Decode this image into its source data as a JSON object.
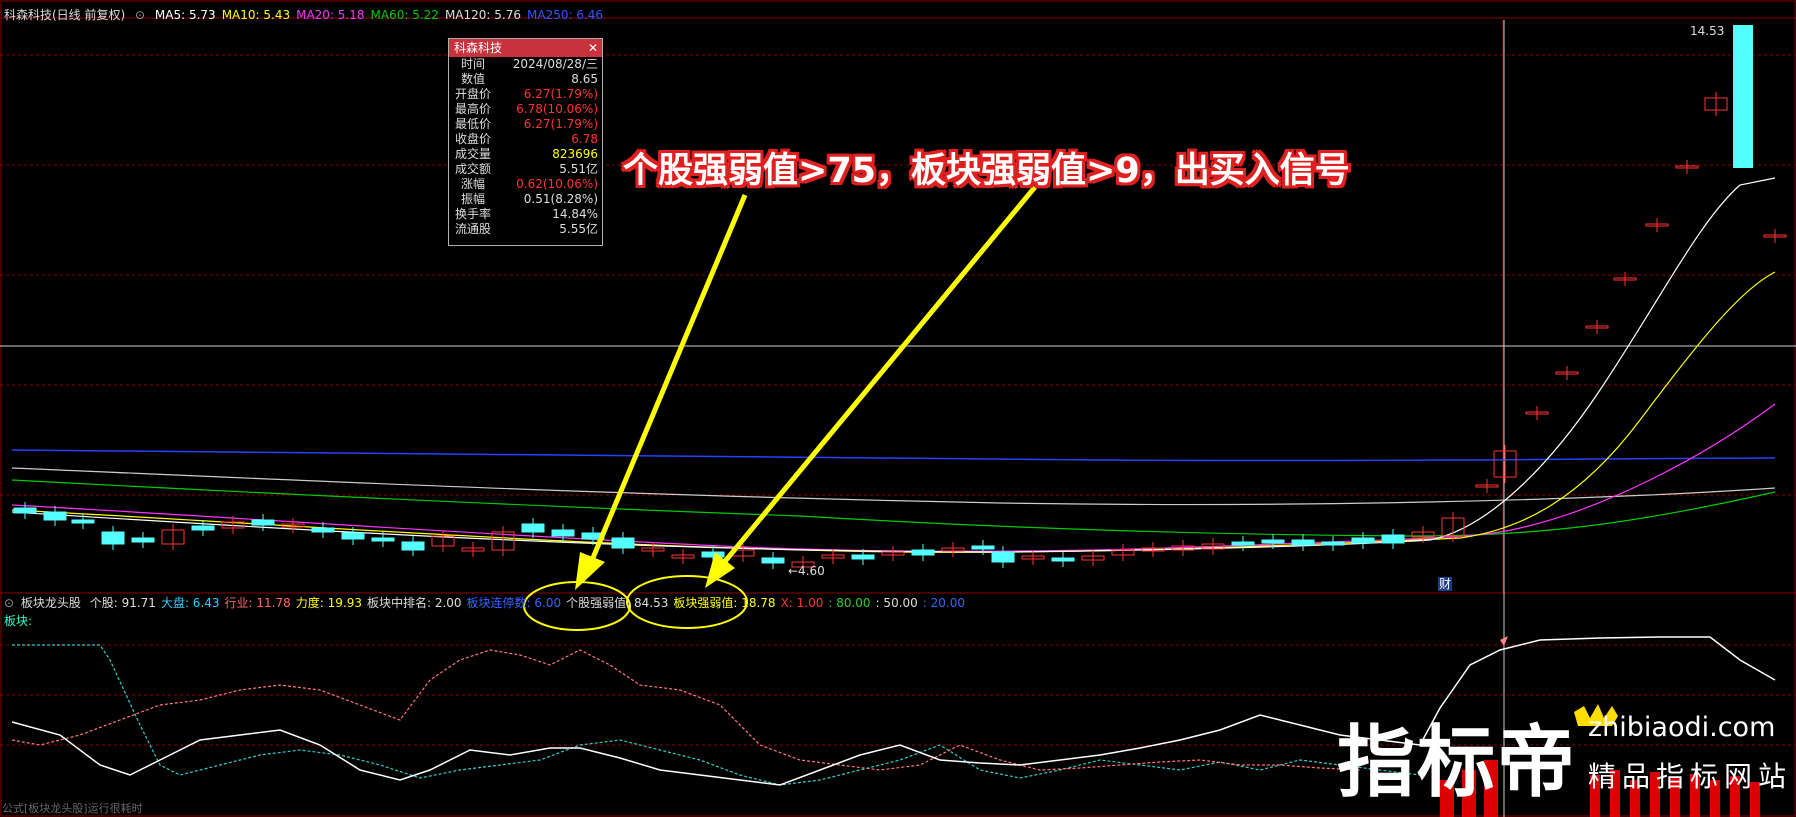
{
  "header": {
    "stock_title": "科森科技(日线 前复权)",
    "ma_items": [
      {
        "label": "MA5: 5.73",
        "color": "#ffffff"
      },
      {
        "label": "MA10: 5.43",
        "color": "#ffff00"
      },
      {
        "label": "MA20: 5.18",
        "color": "#ff33ff"
      },
      {
        "label": "MA60: 5.22",
        "color": "#00cc00"
      },
      {
        "label": "MA120: 5.76",
        "color": "#dddddd"
      },
      {
        "label": "MA250: 6.46",
        "color": "#3355ff"
      }
    ]
  },
  "info_panel": {
    "title": "科森科技",
    "close_glyph": "✕",
    "rows": [
      {
        "key": "时间",
        "value": "2024/08/28/三",
        "color": "#dddddd"
      },
      {
        "key": "数值",
        "value": "8.65",
        "color": "#dddddd"
      },
      {
        "key": "开盘价",
        "value": "6.27(1.79%)",
        "color": "#ff3333"
      },
      {
        "key": "最高价",
        "value": "6.78(10.06%)",
        "color": "#ff3333"
      },
      {
        "key": "最低价",
        "value": "6.27(1.79%)",
        "color": "#ff3333"
      },
      {
        "key": "收盘价",
        "value": "6.78",
        "color": "#ff3333"
      },
      {
        "key": "成交量",
        "value": "823696",
        "color": "#ffff00"
      },
      {
        "key": "成交额",
        "value": "5.51亿",
        "color": "#dddddd"
      },
      {
        "key": "涨幅",
        "value": "0.62(10.06%)",
        "color": "#ff3333"
      },
      {
        "key": "振幅",
        "value": "0.51(8.28%)",
        "color": "#dddddd"
      },
      {
        "key": "换手率",
        "value": "14.84%",
        "color": "#dddddd"
      },
      {
        "key": "流通股",
        "value": "5.55亿",
        "color": "#dddddd"
      }
    ]
  },
  "price_labels": {
    "high": "14.53",
    "low": "←4.60",
    "finance_marker": "财"
  },
  "annotation": {
    "headline": "个股强弱值>75，板块强弱值>9，出买入信号"
  },
  "indicator_bar": {
    "name": "板块龙头股",
    "items": [
      {
        "label": "个股: 91.71",
        "color": "#dddddd"
      },
      {
        "label": "大盘: 6.43",
        "color": "#33ccff"
      },
      {
        "label": "行业: 11.78",
        "color": "#ff6666"
      },
      {
        "label": "力度: 19.93",
        "color": "#ffff00"
      },
      {
        "label": "板块中排名: 2.00",
        "color": "#dddddd"
      },
      {
        "label": "板块连停数: 6.00",
        "color": "#3366ff"
      },
      {
        "label": "个股强弱值: 84.53",
        "color": "#dddddd"
      },
      {
        "label": "板块强弱值: 18.78",
        "color": "#ffff00"
      },
      {
        "label": "X: 1.00",
        "color": "#ff3333"
      },
      {
        "label": ": 80.00",
        "color": "#33cc33"
      },
      {
        "label": ": 50.00",
        "color": "#dddddd"
      },
      {
        "label": ": 20.00",
        "color": "#3366ff"
      }
    ],
    "sector_label": "板块:"
  },
  "status": "公式[板块龙头股]运行很耗时",
  "watermark": {
    "main": "指标帝",
    "url": "zhibiaodi.com",
    "sub": "精品指标网站"
  },
  "colors": {
    "up": "#ff3333",
    "down": "#54ffff",
    "grid": "#8b0000",
    "annotation_arrow": "#ffff00"
  }
}
